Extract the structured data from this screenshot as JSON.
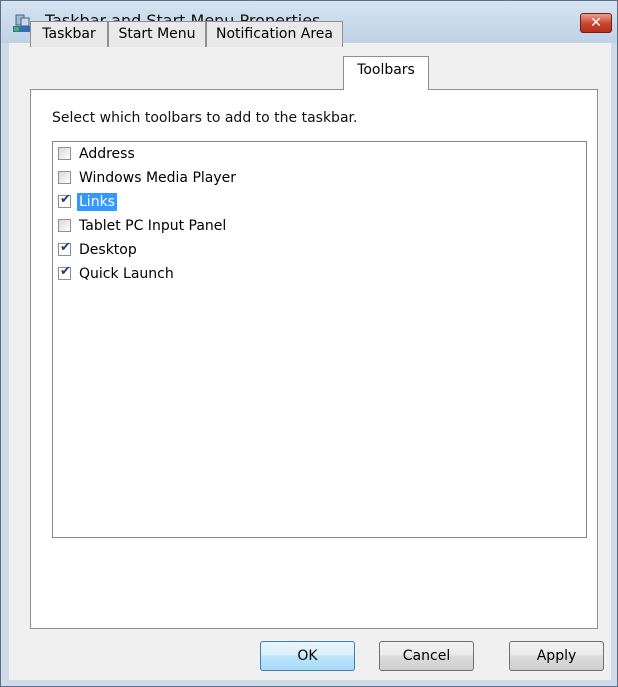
{
  "window": {
    "title": "Taskbar and Start Menu Properties",
    "close_symbol": "✕",
    "app_icon": "taskbar-icon",
    "colors": {
      "close": "#c8432c",
      "selection": "#3399ff"
    }
  },
  "tabs": [
    {
      "label": "Taskbar",
      "active": false
    },
    {
      "label": "Start Menu",
      "active": false
    },
    {
      "label": "Notification Area",
      "active": false
    },
    {
      "label": "Toolbars",
      "active": true
    }
  ],
  "toolbars": {
    "instructions": "Select which toolbars to add to the taskbar.",
    "items": [
      {
        "label": "Address",
        "checked": false,
        "selected": false
      },
      {
        "label": "Windows Media Player",
        "checked": false,
        "selected": false
      },
      {
        "label": "Links",
        "checked": true,
        "selected": true
      },
      {
        "label": "Tablet PC Input Panel",
        "checked": false,
        "selected": false
      },
      {
        "label": "Desktop",
        "checked": true,
        "selected": false
      },
      {
        "label": "Quick Launch",
        "checked": true,
        "selected": false
      }
    ]
  },
  "buttons": {
    "ok": "OK",
    "cancel": "Cancel",
    "apply": "Apply"
  }
}
